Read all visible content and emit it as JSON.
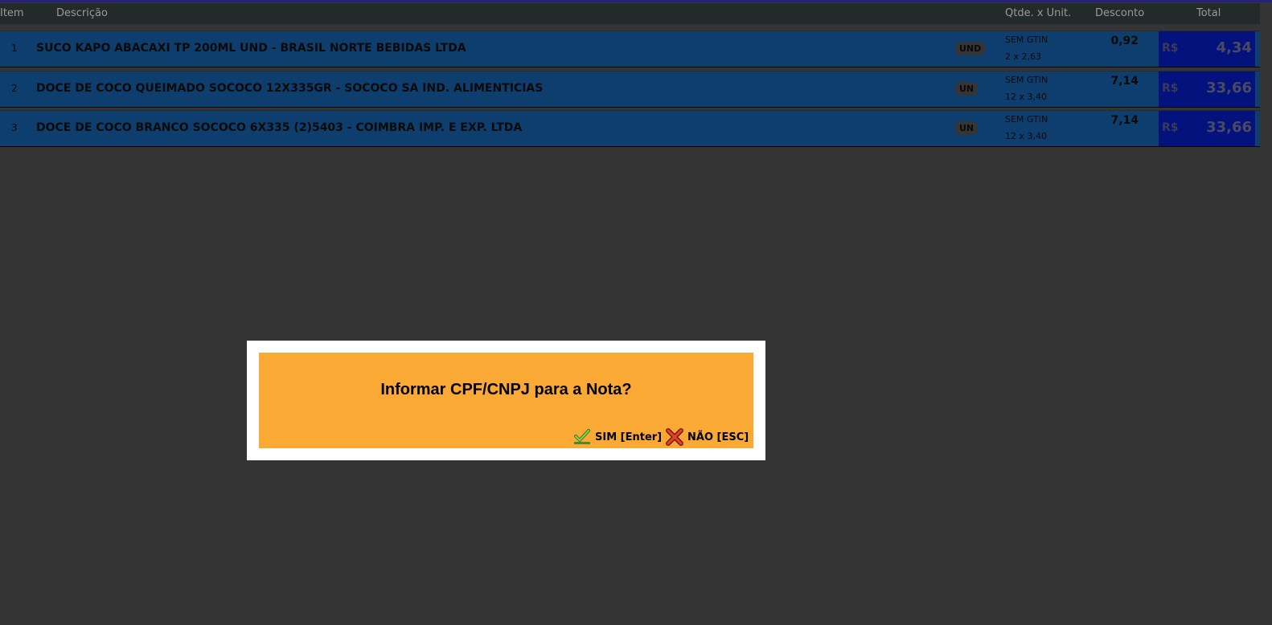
{
  "header": {
    "item": "Item",
    "description": "Descrição",
    "qty_unit": "Qtde. x Unit.",
    "discount": "Desconto",
    "total": "Total"
  },
  "items": [
    {
      "num": "1",
      "description": "SUCO KAPO ABACAXI TP 200ML UND - BRASIL NORTE BEBIDAS LTDA",
      "unit": "UND",
      "gtin": "SEM GTIN",
      "qty": "2 x 2,63",
      "discount": "0,92",
      "currency": "R$",
      "total": "4,34"
    },
    {
      "num": "2",
      "description": "DOCE DE COCO QUEIMADO SOCOCO 12X335GR  - SOCOCO SA IND. ALIMENTICIAS",
      "unit": "UN",
      "gtin": "SEM GTIN",
      "qty": "12 x 3,40",
      "discount": "7,14",
      "currency": "R$",
      "total": "33,66"
    },
    {
      "num": "3",
      "description": "DOCE DE COCO BRANCO SOCOCO 6X335 (2)5403 - COIMBRA IMP. E EXP. LTDA",
      "unit": "UN",
      "gtin": "SEM GTIN",
      "qty": "12 x 3,40",
      "discount": "7,14",
      "currency": "R$",
      "total": "33,66"
    }
  ],
  "dialog": {
    "title": "Informar CPF/CNPJ para a Nota?",
    "yes_label": "SIM [Enter]",
    "no_label": "NÃO [ESC]",
    "yes_icon": "check-icon",
    "no_icon": "cross-icon"
  },
  "colors": {
    "background": "#343434",
    "row": "#0d3e6d",
    "total_box": "#04127e",
    "dialog": "#faa935"
  }
}
